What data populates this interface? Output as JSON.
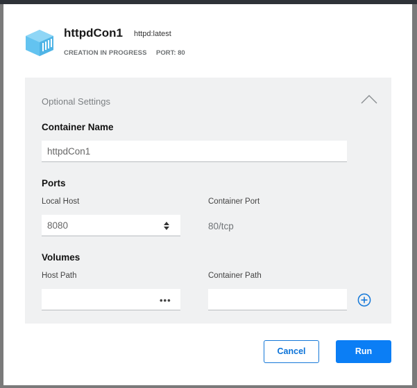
{
  "header": {
    "title": "httpdCon1",
    "image_tag": "httpd:latest",
    "status": "CREATION IN PROGRESS",
    "port": "PORT: 80",
    "icon": "container-icon"
  },
  "optional_settings": {
    "title": "Optional Settings",
    "collapse_icon": "chevron-up-icon",
    "container_name": {
      "label": "Container Name",
      "value": "httpdCon1"
    },
    "ports": {
      "label": "Ports",
      "local_host_label": "Local Host",
      "local_host_value": "8080",
      "container_port_label": "Container Port",
      "container_port_value": "80/tcp"
    },
    "volumes": {
      "label": "Volumes",
      "host_path_label": "Host Path",
      "host_path_value": "",
      "browse_label": "•••",
      "container_path_label": "Container Path",
      "container_path_value": "",
      "add_icon": "plus-circle-icon"
    }
  },
  "actions": {
    "cancel_label": "Cancel",
    "run_label": "Run"
  },
  "colors": {
    "accent": "#0b7ef5",
    "panel_bg": "#f0f1f2",
    "icon_blue": "#5fc2f0"
  }
}
